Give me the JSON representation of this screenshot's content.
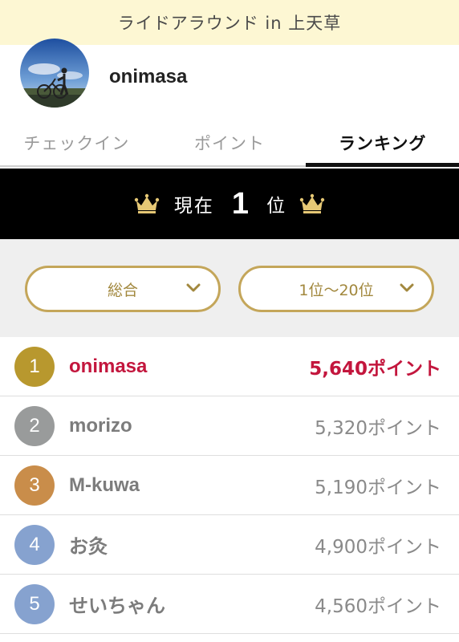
{
  "header": {
    "title": "ライドアラウンド in 上天草"
  },
  "profile": {
    "username": "onimasa"
  },
  "tabs": [
    {
      "label": "チェックイン",
      "active": false
    },
    {
      "label": "ポイント",
      "active": false
    },
    {
      "label": "ランキング",
      "active": true
    }
  ],
  "current_rank": {
    "prefix": "現在",
    "rank": "1",
    "suffix": "位"
  },
  "filters": {
    "category": "総合",
    "range": "1位〜20位"
  },
  "ranking": [
    {
      "rank": "1",
      "name": "onimasa",
      "points": "5,640ポイント",
      "badge_color": "#b8982e",
      "is_me": true
    },
    {
      "rank": "2",
      "name": "morizo",
      "points": "5,320ポイント",
      "badge_color": "#999b9b",
      "is_me": false
    },
    {
      "rank": "3",
      "name": "M-kuwa",
      "points": "5,190ポイント",
      "badge_color": "#c98d4a",
      "is_me": false
    },
    {
      "rank": "4",
      "name": "お灸",
      "points": "4,900ポイント",
      "badge_color": "#86a2cf",
      "is_me": false
    },
    {
      "rank": "5",
      "name": "せいちゃん",
      "points": "4,560ポイント",
      "badge_color": "#86a2cf",
      "is_me": false
    }
  ],
  "colors": {
    "accent_gold": "#c4a65a",
    "highlight_red": "#c3163d",
    "header_bg": "#fdf7d3"
  }
}
